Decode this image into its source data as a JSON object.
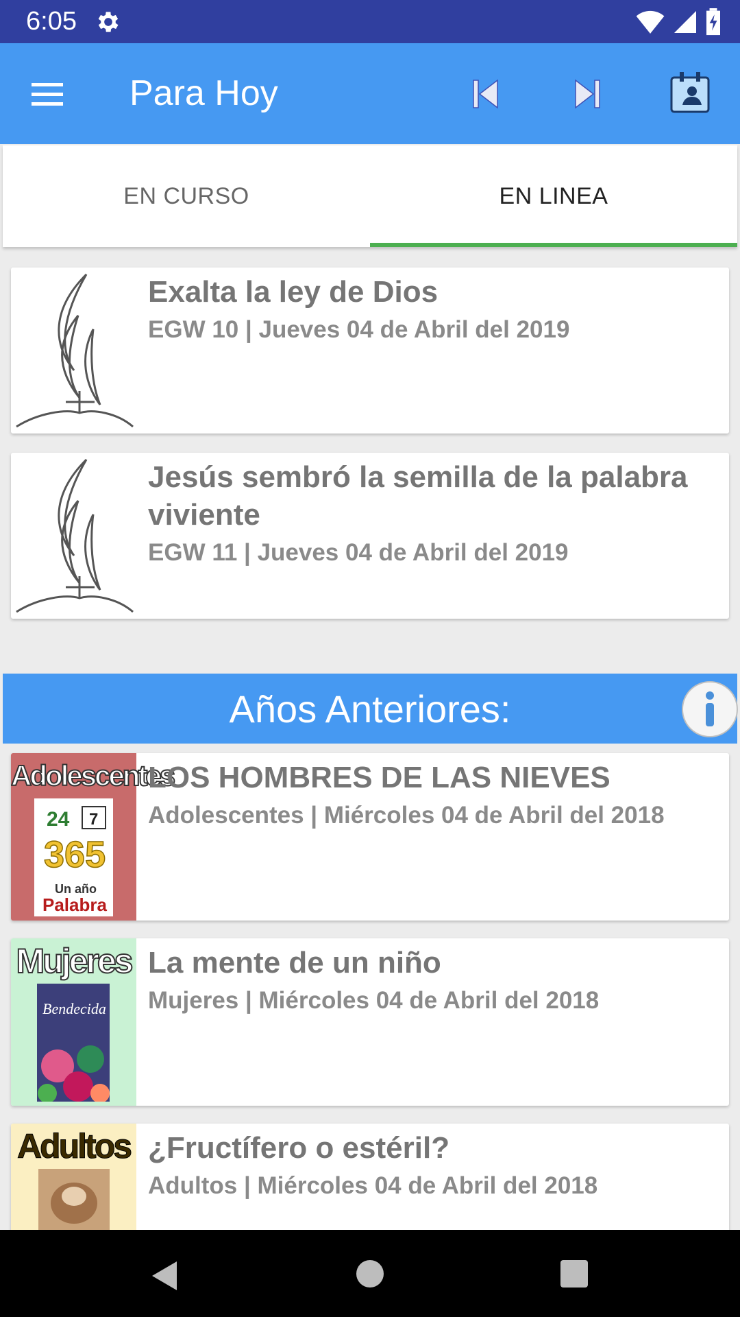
{
  "status_bar": {
    "time": "6:05",
    "icons": [
      "gear-icon",
      "wifi-icon",
      "signal-icon",
      "battery-icon"
    ]
  },
  "app_bar": {
    "title": "Para Hoy",
    "icons": [
      "menu-icon",
      "skip-previous-icon",
      "skip-next-icon",
      "calendar-contact-icon"
    ],
    "background": "#4699f2"
  },
  "tabs": [
    {
      "label": "EN CURSO",
      "selected": false
    },
    {
      "label": "EN LINEA",
      "selected": true
    }
  ],
  "tab_indicator_color": "#4caf50",
  "current_items": [
    {
      "title": "Exalta la ley de Dios",
      "subtitle": "EGW 10 | Jueves 04 de Abril del 2019",
      "thumb": "adventist-logo-icon"
    },
    {
      "title": "Jesús sembró la semilla de la palabra viviente",
      "subtitle": "EGW 11 | Jueves 04 de Abril del 2019",
      "thumb": "adventist-logo-icon"
    }
  ],
  "previous_section": {
    "title": "Años Anteriores:",
    "info_icon": "info-icon"
  },
  "previous_items": [
    {
      "thumb_label": "Adolescentes",
      "title": "LOS HOMBRES DE LAS NIEVES",
      "subtitle": "Adolescentes  | Miércoles 04 de Abril del 2018",
      "thumb_bg": "#c86b6b"
    },
    {
      "thumb_label": "Mujeres",
      "title": "La mente de un niño",
      "subtitle": "Mujeres  | Miércoles 04 de Abril del 2018",
      "thumb_bg": "#c9f2d4"
    },
    {
      "thumb_label": "Adultos",
      "title": "¿Fructífero o estéril?",
      "subtitle": "Adultos  | Miércoles 04 de Abril del 2018",
      "thumb_bg": "#fbefc2"
    }
  ],
  "nav_bar": {
    "icons": [
      "back-icon",
      "home-icon",
      "recents-icon"
    ]
  }
}
